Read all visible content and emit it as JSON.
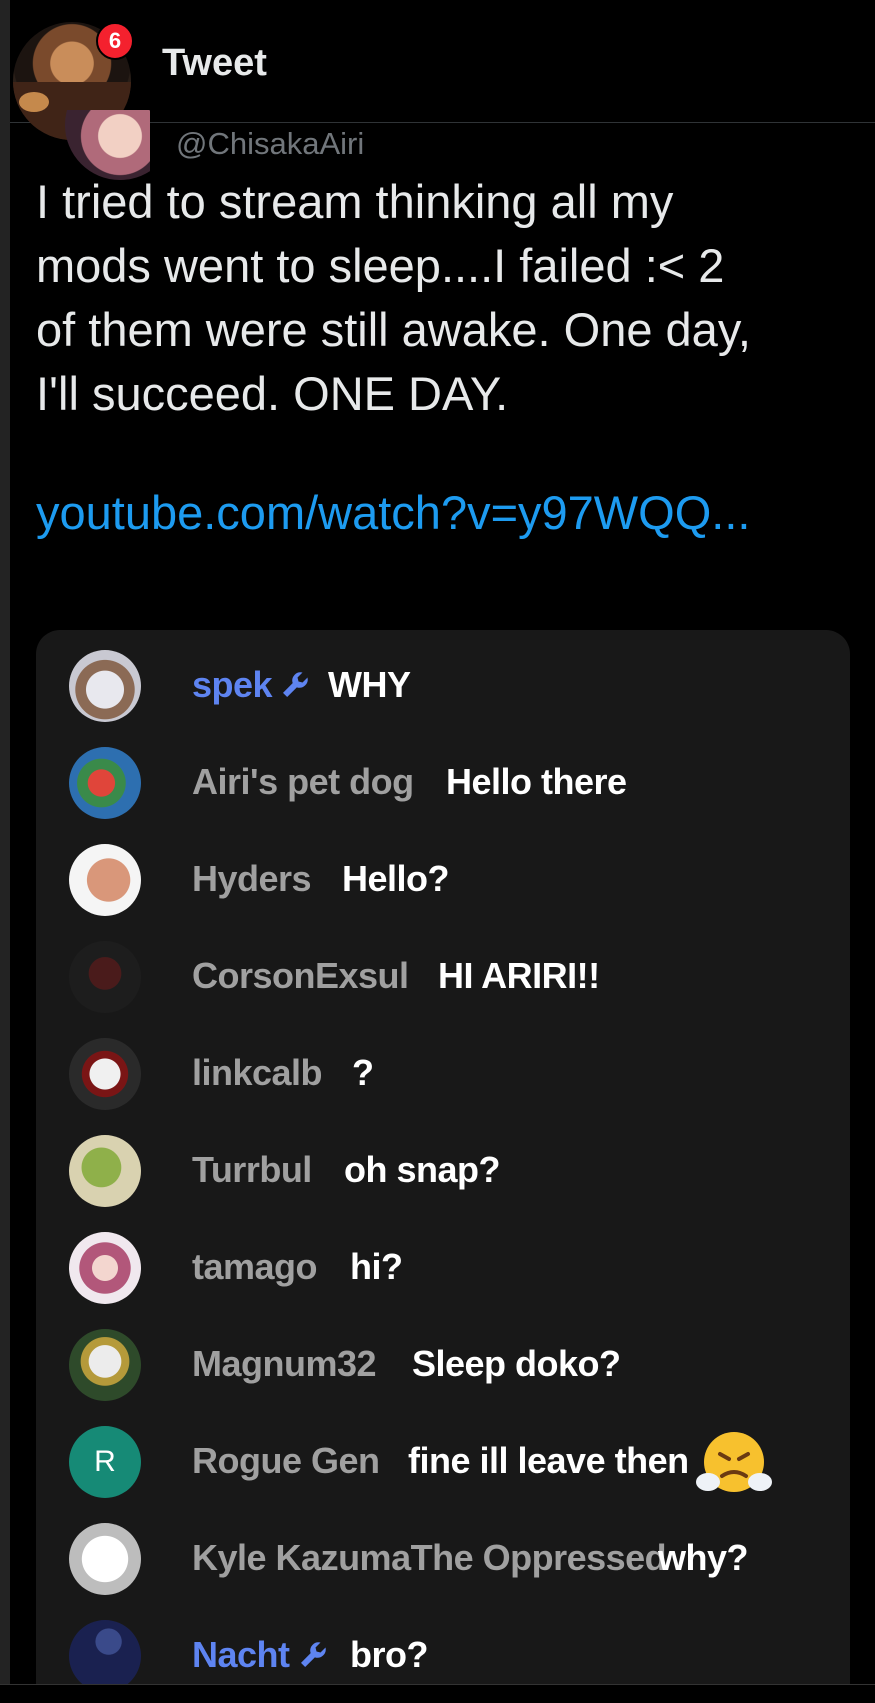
{
  "header": {
    "title": "Tweet",
    "notification_count": "6"
  },
  "tweet": {
    "handle": "@ChisakaAiri",
    "text_lines": [
      "I tried to stream thinking all my",
      "mods went to sleep....I failed :< 2",
      "of them were still awake. One day,",
      "I'll succeed. ONE DAY."
    ],
    "link": "youtube.com/watch?v=y97WQQ..."
  },
  "chat": {
    "messages": [
      {
        "name": "spek",
        "moderator": true,
        "message": "WHY"
      },
      {
        "name": "Airi's pet dog",
        "moderator": false,
        "message": "Hello there"
      },
      {
        "name": "Hyders",
        "moderator": false,
        "message": "Hello?"
      },
      {
        "name": "CorsonExsul",
        "moderator": false,
        "message": "HI ARIRI!!"
      },
      {
        "name": "linkcalb",
        "moderator": false,
        "message": "?"
      },
      {
        "name": "Turrbul",
        "moderator": false,
        "message": "oh snap?"
      },
      {
        "name": "tamago",
        "moderator": false,
        "message": "hi?"
      },
      {
        "name": "Magnum32",
        "moderator": false,
        "message": "Sleep doko?"
      },
      {
        "name": "Rogue Gen",
        "moderator": false,
        "message": "fine ill leave then",
        "emoji": "steaming-face-emoji",
        "avatar_letter": "R"
      },
      {
        "name": "Kyle KazumaThe Oppressed",
        "moderator": false,
        "message": "why?"
      },
      {
        "name": "Nacht",
        "moderator": true,
        "message": "bro?"
      }
    ]
  },
  "colors": {
    "background": "#000000",
    "card": "#181818",
    "link": "#1d9bf0",
    "moderator": "#5e84f1",
    "username": "#a0a0a0",
    "badge": "#f4212e"
  }
}
